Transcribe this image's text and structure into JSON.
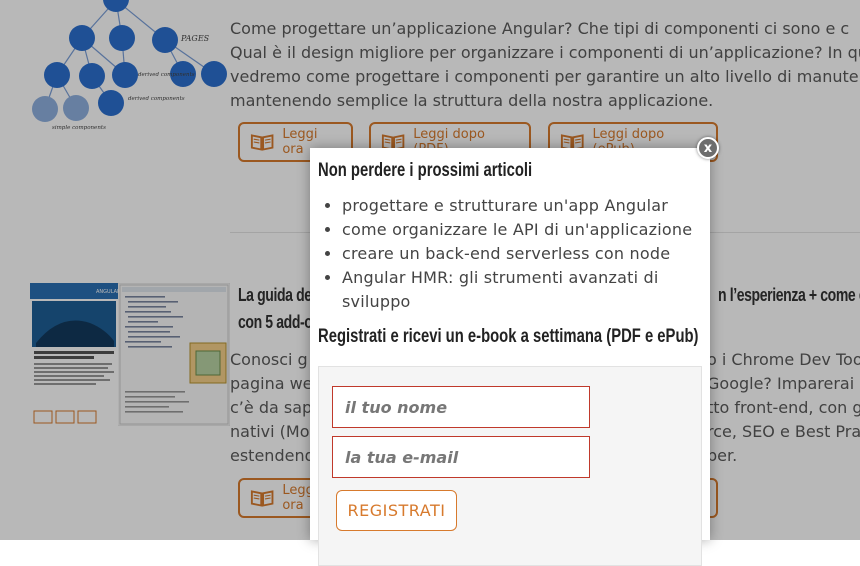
{
  "articles": [
    {
      "text_lines": [
        "Come progettare un’applicazione Angular? Che tipi di componenti ci sono e c",
        "Qual è il design migliore per organizzare i componenti di un’applicazione? In qu",
        "vedremo come progettare i componenti per garantire un alto livello di manute",
        "mantenendo semplice la struttura della nostra applicazione."
      ],
      "buttons": [
        "Leggi ora",
        "Leggi dopo (PDF)",
        "Leggi dopo (ePub)"
      ],
      "diagram_labels": [
        "PAGES",
        "derived components",
        "derived components",
        "simple components"
      ]
    },
    {
      "title_lines": [
        "La guida de",
        "n l’esperienza + come es",
        "con 5 add-o"
      ],
      "text_lines": [
        [
          "Conosci g",
          "o i Chrome Dev Too"
        ],
        [
          "pagina we",
          "Google? Imparerai"
        ],
        [
          "c’è da sap",
          "tto front-end, con g"
        ],
        [
          "nativi (Mo",
          "rce, SEO e Best Pra"
        ],
        [
          "estendend",
          "per."
        ]
      ],
      "buttons": [
        "Leggi ora"
      ],
      "thumb_title": "ANGULAR",
      "thumb_caption": "I 5 strumenti essenziali in locale con Angular e front-end - Parte 2: Autodifese per eliminare i tentativi e ripetitivi"
    }
  ],
  "popup": {
    "close_label": "x",
    "heading": "Non perdere i prossimi articoli",
    "bullets": [
      "progettare e strutturare un'app Angular",
      "come organizzare le API di un'applicazione",
      "creare un back-end serverless con node",
      "Angular HMR: gli strumenti avanzati di sviluppo"
    ],
    "subheading": "Registrati e ricevi un e-book a settimana (PDF e ePub)",
    "name_placeholder": "il tuo nome",
    "email_placeholder": "la tua e-mail",
    "submit_label": "REGISTRATI"
  },
  "colors": {
    "accent": "#d77a2d",
    "diagram_node": "#2b6fcf",
    "diagram_node_light": "#8fb0e0",
    "field_border": "#c0392b"
  },
  "icons": {
    "book": "book-icon",
    "close": "close-icon"
  }
}
